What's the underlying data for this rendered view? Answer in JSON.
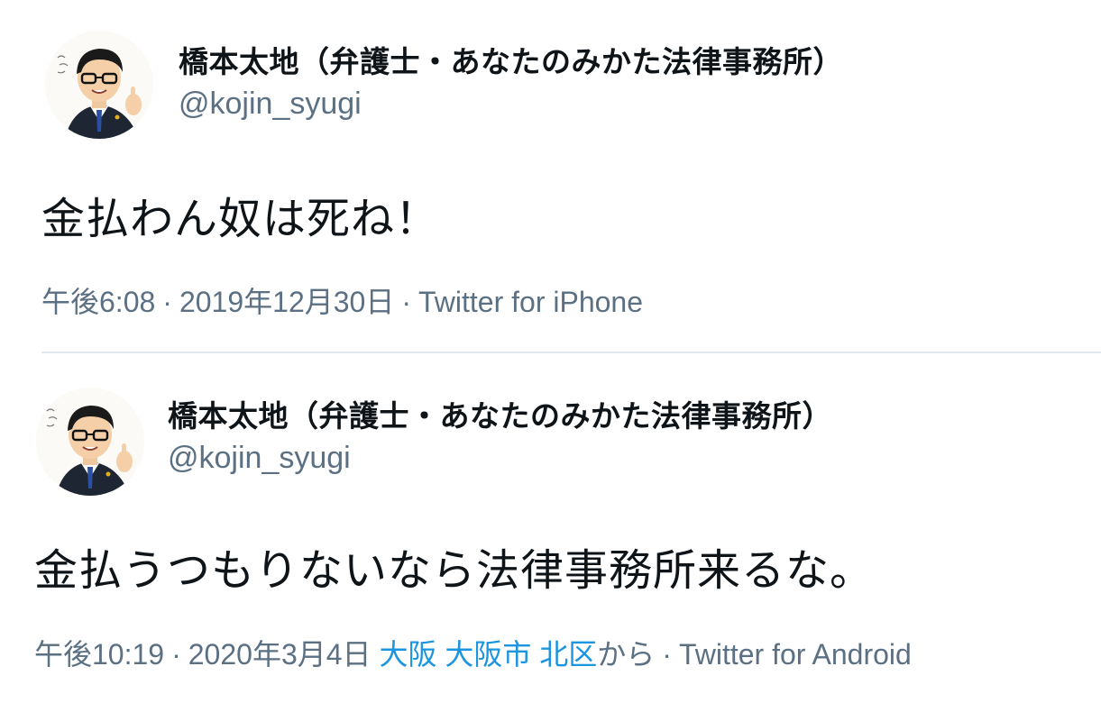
{
  "tweets": [
    {
      "display_name": "橋本太地（弁護士・あなたのみかた法律事務所）",
      "handle": "@kojin_syugi",
      "text": "金払わん奴は死ね！",
      "time": "午後6:08",
      "date": "2019年12月30日",
      "location_parts": [],
      "location_suffix": "",
      "client": "Twitter for iPhone",
      "avatar_icon": "cartoon-lawyer-avatar-icon"
    },
    {
      "display_name": "橋本太地（弁護士・あなたのみかた法律事務所）",
      "handle": "@kojin_syugi",
      "text": "金払うつもりないなら法律事務所来るな。",
      "time": "午後10:19",
      "date": "2020年3月4日",
      "location_parts": [
        "大阪",
        "大阪市",
        "北区"
      ],
      "location_suffix": "から",
      "client": "Twitter for Android",
      "avatar_icon": "cartoon-lawyer-avatar-icon"
    }
  ],
  "colors": {
    "text_primary": "#0f1419",
    "text_secondary": "#5b7083",
    "link": "#1b95e0",
    "divider": "#e1e8ed"
  },
  "meta_separator": "·"
}
